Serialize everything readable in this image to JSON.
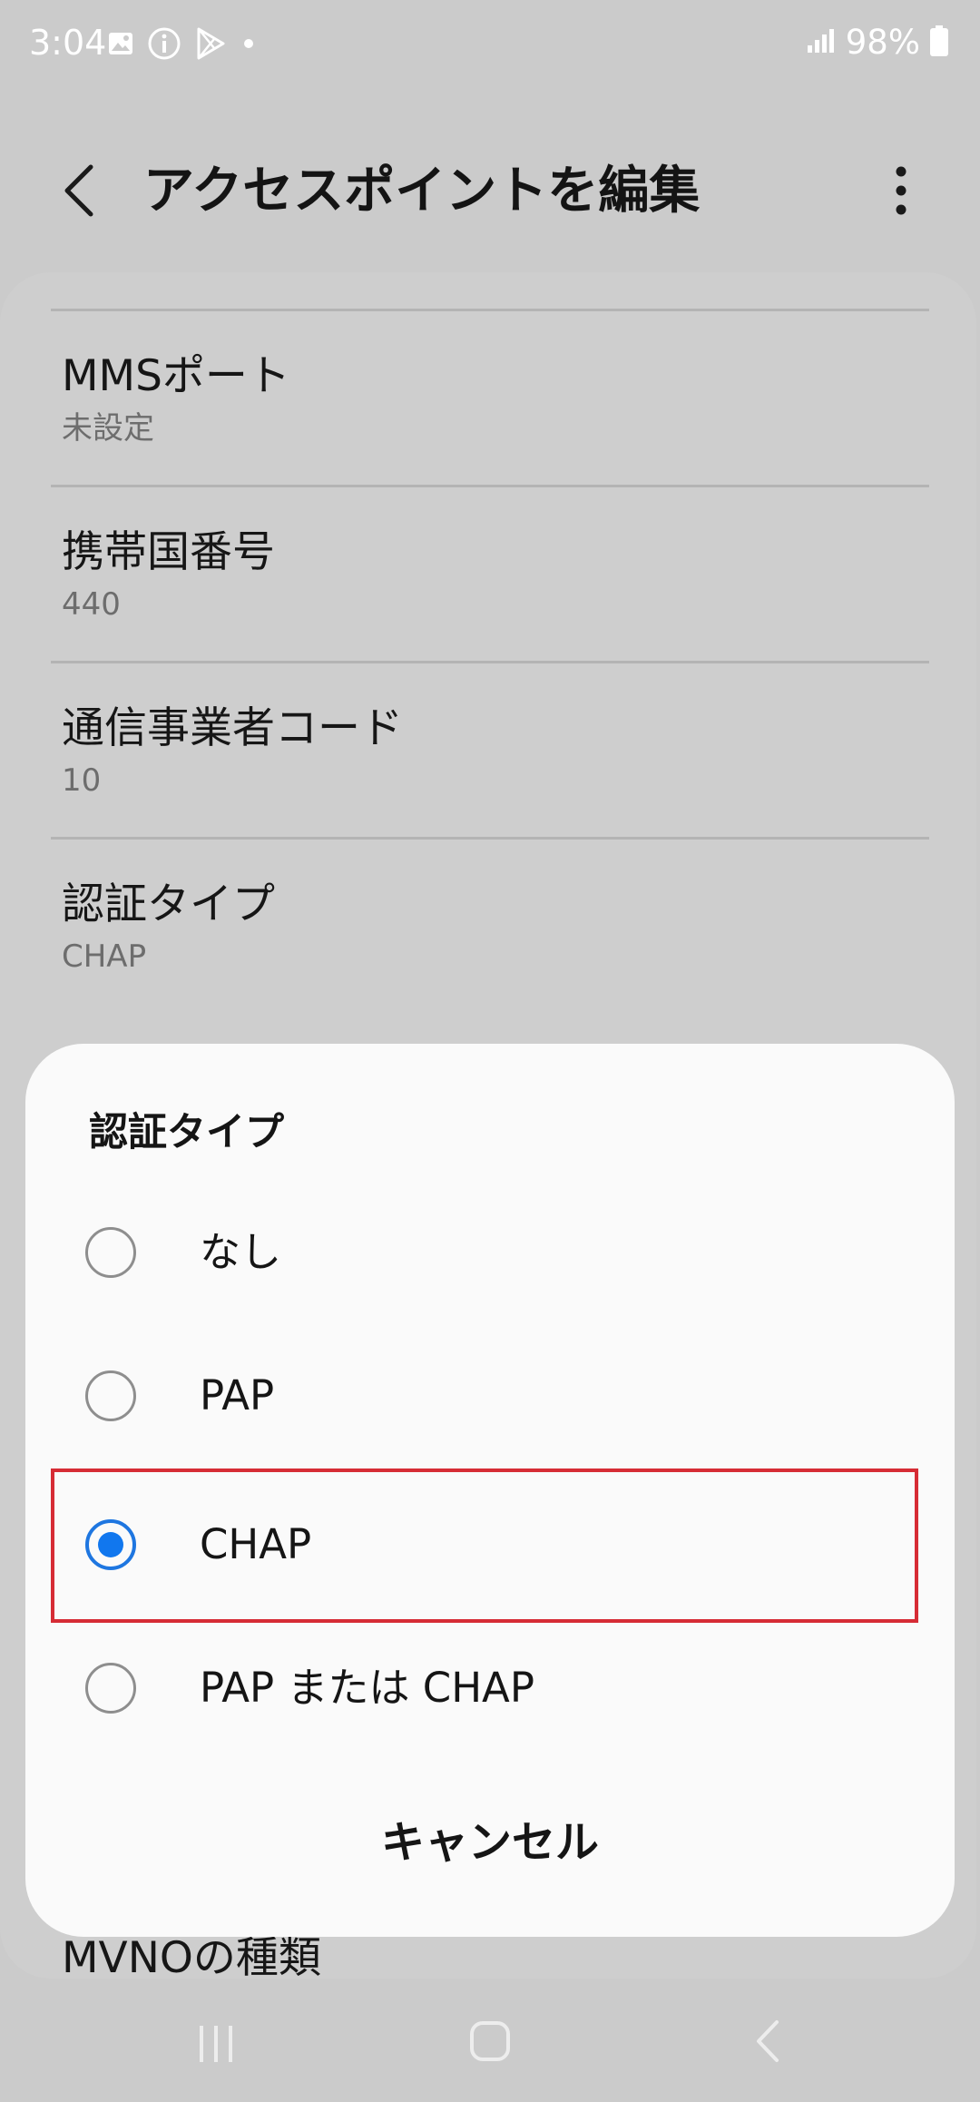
{
  "status_bar": {
    "time": "3:04",
    "battery": "98%",
    "icons": [
      "gallery-icon",
      "info-icon",
      "play-store-icon",
      "notification-dot-icon",
      "signal-icon",
      "battery-icon"
    ]
  },
  "app_bar": {
    "title": "アクセスポイントを編集",
    "back_icon": "back-arrow-icon",
    "more_icon": "more-vertical-icon"
  },
  "settings": {
    "items": [
      {
        "title": "MMSポート",
        "value": "未設定"
      },
      {
        "title": "携帯国番号",
        "value": "440"
      },
      {
        "title": "通信事業者コード",
        "value": "10"
      },
      {
        "title": "認証タイプ",
        "value": "CHAP"
      }
    ],
    "partial_item": {
      "title": "MVNOの種類"
    }
  },
  "dialog": {
    "title": "認証タイプ",
    "options": [
      {
        "label": "なし",
        "selected": false
      },
      {
        "label": "PAP",
        "selected": false
      },
      {
        "label": "CHAP",
        "selected": true
      },
      {
        "label": "PAP または CHAP",
        "selected": false
      }
    ],
    "cancel_label": "キャンセル"
  },
  "nav_bar": {
    "buttons": [
      "recent-apps-icon",
      "home-icon",
      "back-icon"
    ]
  },
  "colors": {
    "accent": "#1177ee",
    "highlight": "#d62c35",
    "background": "#cbcbcb",
    "dialog_bg": "#fafafa"
  }
}
